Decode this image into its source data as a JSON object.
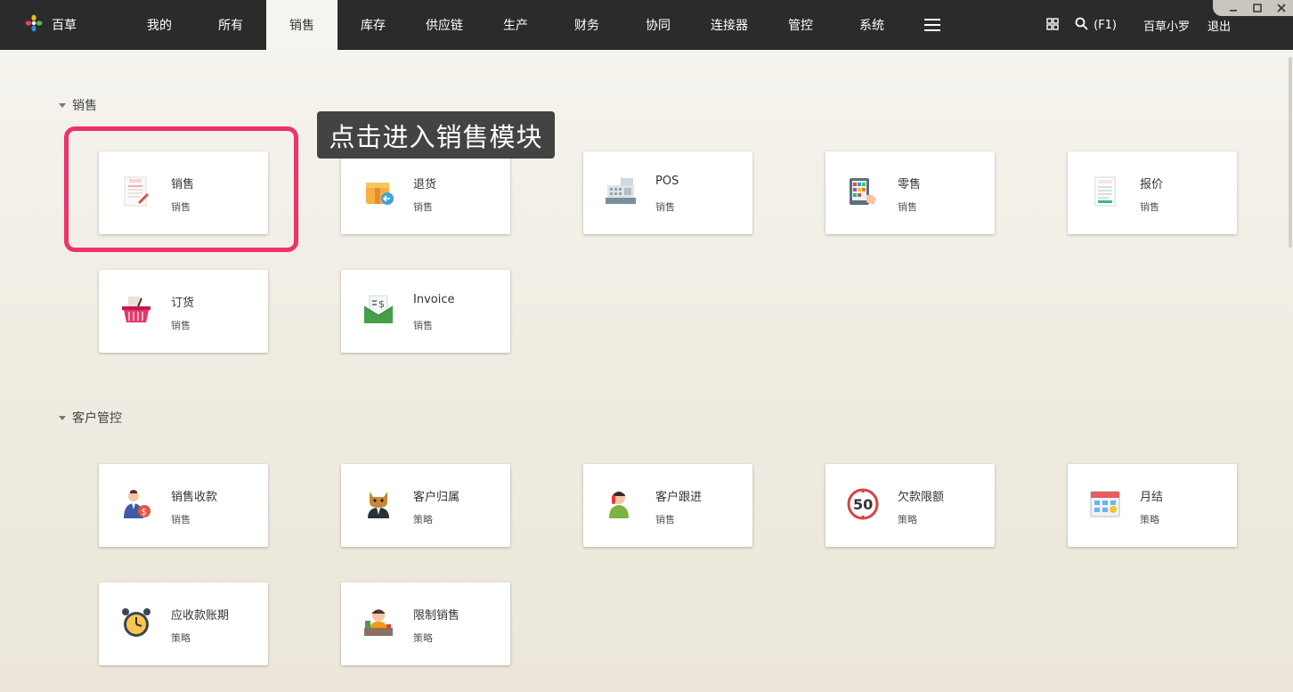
{
  "app": {
    "brand_name": "百草"
  },
  "nav": {
    "items": [
      {
        "label": "我的",
        "active": false
      },
      {
        "label": "所有",
        "active": false
      },
      {
        "label": "销售",
        "active": true
      },
      {
        "label": "库存",
        "active": false
      },
      {
        "label": "供应链",
        "active": false
      },
      {
        "label": "生产",
        "active": false
      },
      {
        "label": "财务",
        "active": false
      },
      {
        "label": "协同",
        "active": false
      },
      {
        "label": "连接器",
        "active": false
      },
      {
        "label": "管控",
        "active": false
      },
      {
        "label": "系统",
        "active": false
      }
    ],
    "menu_icon": "hamburger-icon"
  },
  "toolbar": {
    "grid_icon": "grid-icon",
    "search_icon": "search-icon",
    "search_shortcut": "(F1)",
    "user_name": "百草小罗",
    "logout_label": "退出"
  },
  "sections": [
    {
      "title": "销售",
      "cards": [
        {
          "title": "销售",
          "subtitle": "销售",
          "icon": "sales-order-icon"
        },
        {
          "title": "退货",
          "subtitle": "销售",
          "icon": "return-box-icon"
        },
        {
          "title": "POS",
          "subtitle": "销售",
          "icon": "cash-register-icon"
        },
        {
          "title": "零售",
          "subtitle": "销售",
          "icon": "retail-terminal-icon"
        },
        {
          "title": "报价",
          "subtitle": "销售",
          "icon": "quote-document-icon"
        },
        {
          "title": "订货",
          "subtitle": "销售",
          "icon": "shopping-basket-icon"
        },
        {
          "title": "Invoice",
          "subtitle": "销售",
          "icon": "invoice-envelope-icon"
        }
      ]
    },
    {
      "title": "客户管控",
      "cards": [
        {
          "title": "销售收款",
          "subtitle": "销售",
          "icon": "payment-collector-icon"
        },
        {
          "title": "客户归属",
          "subtitle": "策略",
          "icon": "cat-owner-icon"
        },
        {
          "title": "客户跟进",
          "subtitle": "销售",
          "icon": "phone-call-icon"
        },
        {
          "title": "欠款限额",
          "subtitle": "策略",
          "icon": "limit-50-icon"
        },
        {
          "title": "月结",
          "subtitle": "策略",
          "icon": "calendar-icon"
        },
        {
          "title": "应收款账期",
          "subtitle": "策略",
          "icon": "alarm-clock-icon"
        },
        {
          "title": "限制销售",
          "subtitle": "策略",
          "icon": "restricted-seller-icon"
        }
      ]
    }
  ],
  "tooltip": {
    "text": "点击进入销售模块"
  },
  "colors": {
    "topbar": "#2b2b2b",
    "highlight": "#f0316b",
    "tooltip_bg": "#303030"
  }
}
